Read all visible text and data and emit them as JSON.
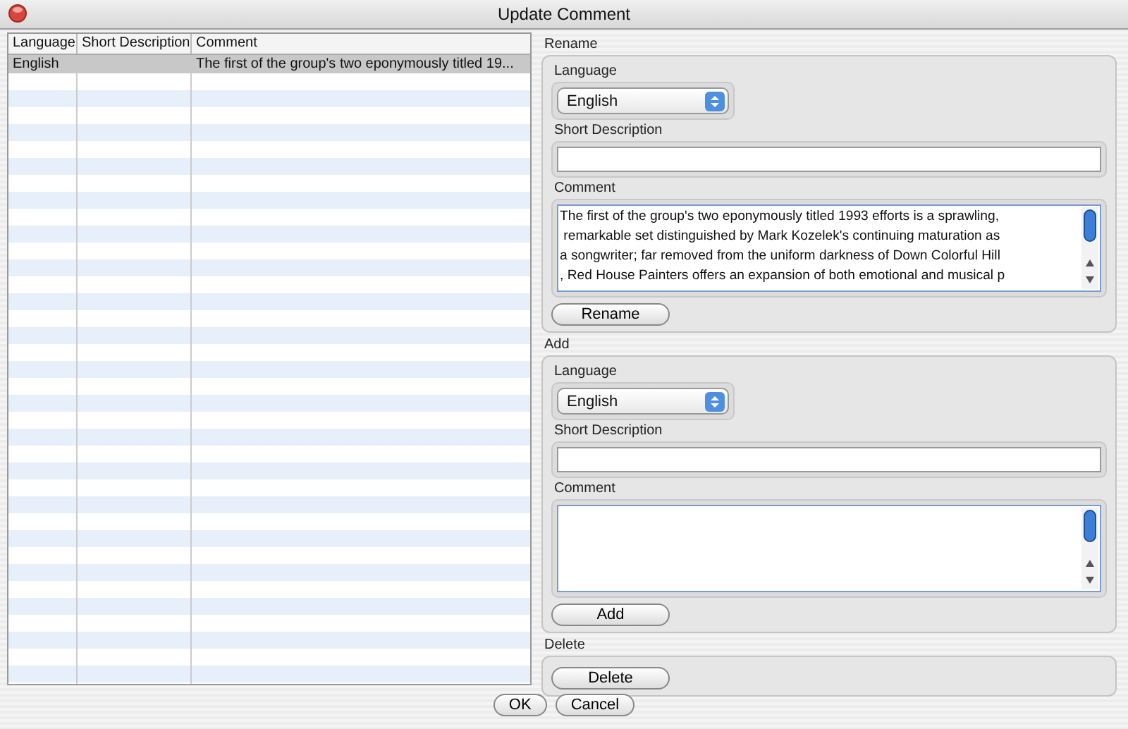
{
  "window": {
    "title": "Update Comment"
  },
  "table": {
    "columns": [
      "Language",
      "Short Description",
      "Comment"
    ],
    "rows": [
      {
        "cells": [
          "English",
          null,
          "The first of the group's two eponymously titled 19..."
        ],
        "selected": true
      }
    ]
  },
  "sections": [
    {
      "kind": "form",
      "title": "Rename",
      "language_label": "Language",
      "language": "English",
      "short_label": "Short Description",
      "comment_label": "Comment",
      "comment_lines": [
        "The first of the group's two eponymously titled 1993 efforts is a sprawling,",
        " remarkable set distinguished by Mark Kozelek's continuing maturation as",
        "a songwriter; far removed from the uniform darkness of Down Colorful Hill",
        ", Red House Painters offers an expansion of both emotional and musical p"
      ],
      "button": "Rename"
    },
    {
      "kind": "form",
      "title": "Add",
      "language_label": "Language",
      "language": "English",
      "short_label": "Short Description",
      "comment_label": "Comment",
      "button": "Add"
    },
    {
      "kind": "button_only",
      "title": "Delete",
      "button": "Delete"
    }
  ],
  "buttons": [
    "OK",
    "Cancel"
  ]
}
